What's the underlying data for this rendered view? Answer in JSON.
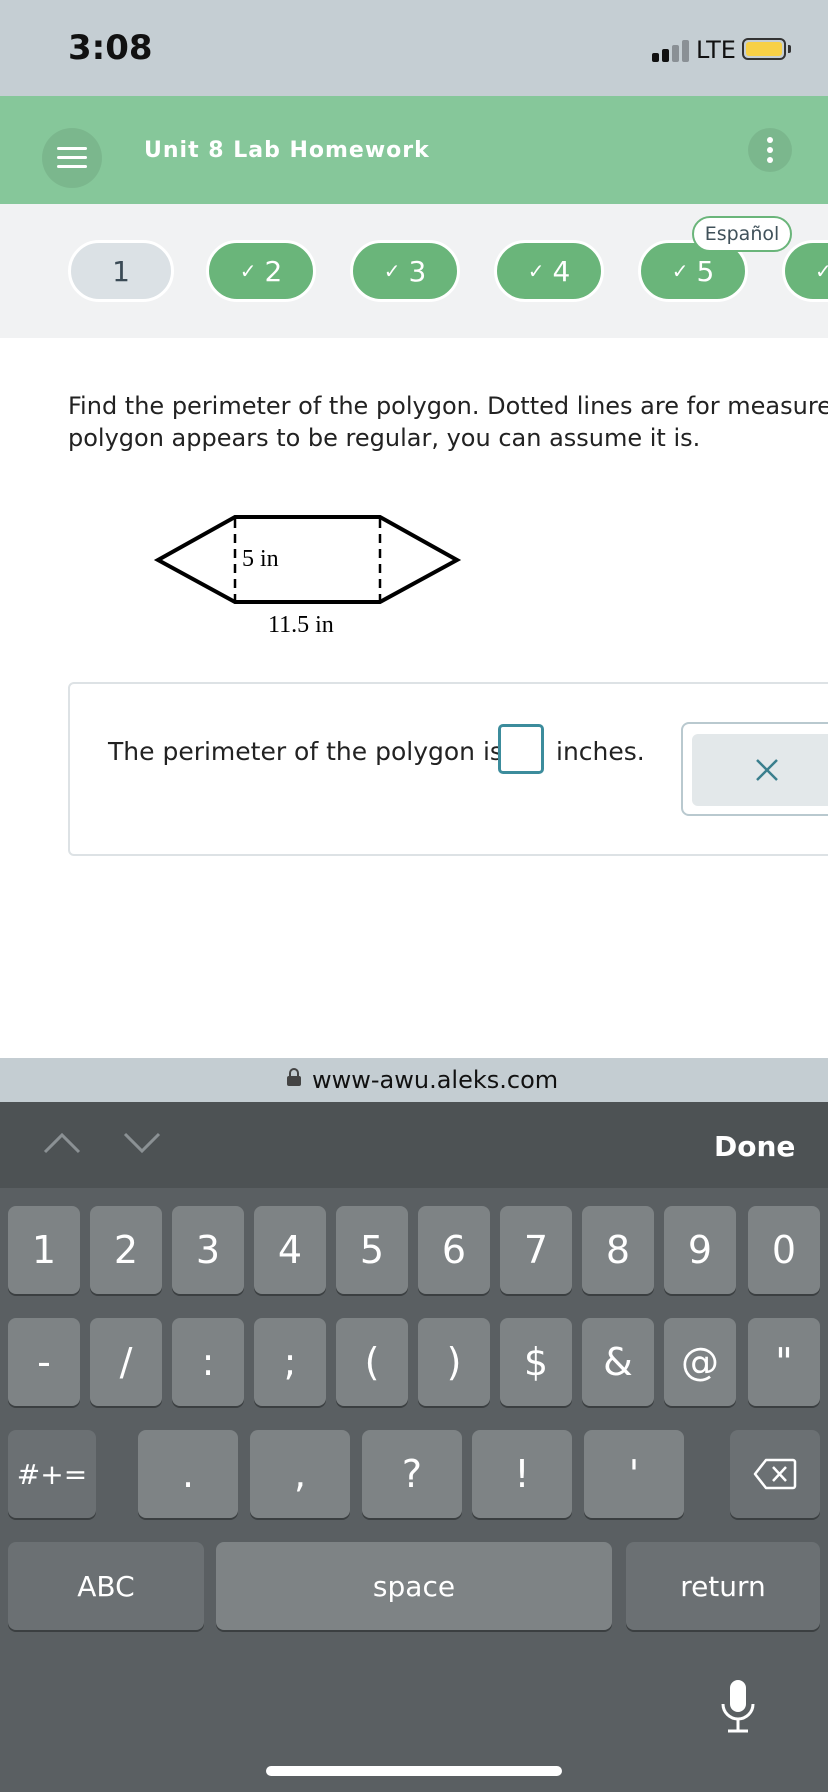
{
  "status_bar": {
    "time": "3:08",
    "network": "LTE",
    "battery_color": "#f7d046"
  },
  "header": {
    "title": "Unit 8 Lab Homework",
    "bg_color": "#86c79a"
  },
  "progress": {
    "items": [
      {
        "label": "1",
        "checked": false
      },
      {
        "label": "2",
        "checked": true
      },
      {
        "label": "3",
        "checked": true
      },
      {
        "label": "4",
        "checked": true
      },
      {
        "label": "5",
        "checked": true
      },
      {
        "label": "",
        "checked": true
      }
    ],
    "check_glyph": "✓",
    "language_label": "Español",
    "done_color": "#6ab57a",
    "current_color": "#dbe1e5"
  },
  "question": {
    "line1": "Find the perimeter of the polygon. Dotted lines are for measure",
    "line2": "polygon appears to be regular, you can assume it is."
  },
  "figure": {
    "height_label": "5 in",
    "width_label": "11.5 in"
  },
  "answer": {
    "lead": "The perimeter of the polygon is",
    "unit": "inches.",
    "value": ""
  },
  "url": "www-awu.aleks.com",
  "keyboard": {
    "done_label": "Done",
    "row1": [
      "1",
      "2",
      "3",
      "4",
      "5",
      "6",
      "7",
      "8",
      "9",
      "0"
    ],
    "row2": [
      "-",
      "/",
      ":",
      ";",
      "(",
      ")",
      "$",
      "&",
      "@",
      "\""
    ],
    "row3": [
      ".",
      ",",
      "?",
      "!",
      "'"
    ],
    "symbols_label": "#+=",
    "abc_label": "ABC",
    "space_label": "space",
    "return_label": "return",
    "icons": [
      "chevron-up-icon",
      "chevron-down-icon",
      "backspace-icon",
      "microphone-icon",
      "lock-icon",
      "close-icon",
      "menu-icon",
      "more-vertical-icon"
    ]
  }
}
